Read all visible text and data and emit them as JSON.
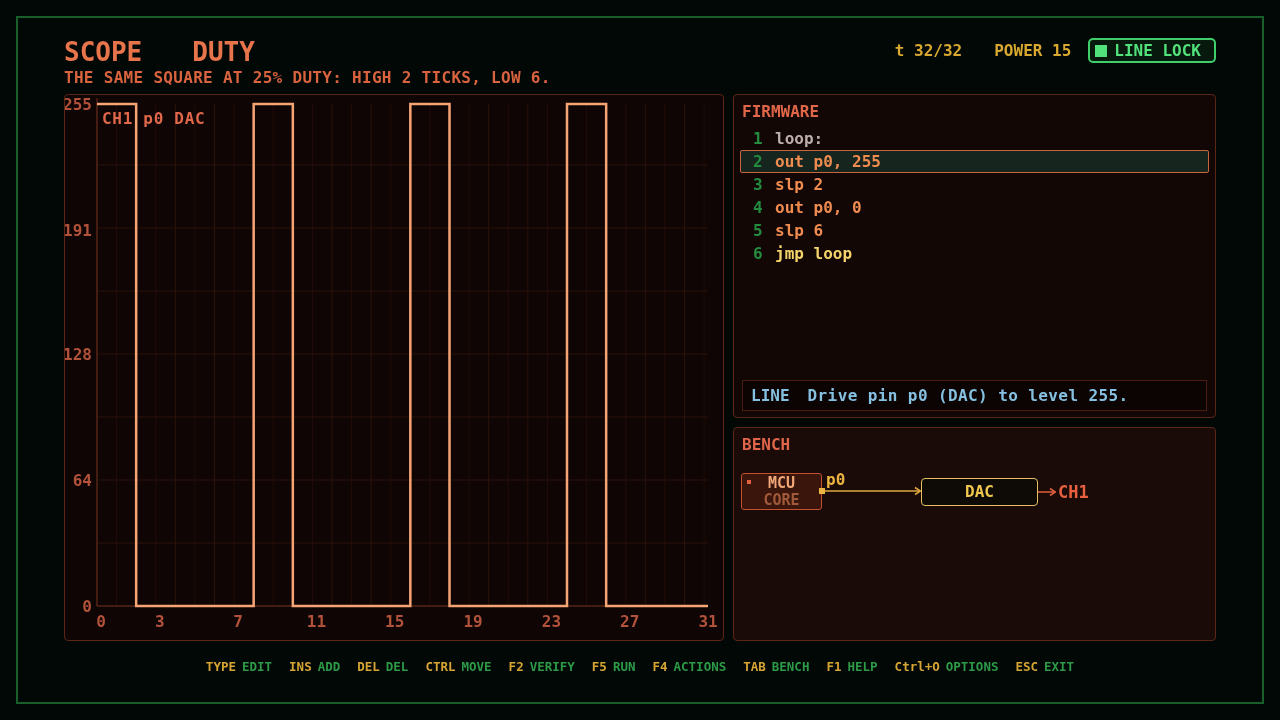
{
  "header": {
    "mode": "SCOPE",
    "title": "DUTY",
    "subtitle": "THE SAME SQUARE AT 25% DUTY: HIGH 2 TICKS, LOW 6.",
    "time": "t 32/32",
    "power": "POWER 15",
    "line_lock": {
      "label": "LINE LOCK",
      "on": true
    }
  },
  "scope": {
    "chart_data": {
      "type": "line",
      "x": [
        0,
        2,
        2,
        8,
        8,
        10,
        10,
        16,
        16,
        18,
        18,
        24,
        24,
        26,
        26,
        31.2
      ],
      "series": [
        {
          "name": "CH1 p0 DAC",
          "color": "#f6a474",
          "values": [
            255,
            255,
            0,
            0,
            255,
            255,
            0,
            0,
            255,
            255,
            0,
            0,
            255,
            255,
            0,
            0
          ]
        }
      ],
      "xlim": [
        0,
        31.2
      ],
      "ylim": [
        0,
        255
      ],
      "xticks": [
        0,
        3,
        7,
        11,
        15,
        19,
        23,
        27,
        31
      ],
      "yticks": [
        0,
        64,
        128,
        191,
        255
      ],
      "grid": true
    }
  },
  "firmware": {
    "title": "FIRMWARE",
    "lines": [
      {
        "number": "1",
        "code": "loop:",
        "kind": "label",
        "selected": false
      },
      {
        "number": "2",
        "code": "out p0, 255",
        "kind": "op",
        "selected": true
      },
      {
        "number": "3",
        "code": "slp 2",
        "kind": "op",
        "selected": false
      },
      {
        "number": "4",
        "code": "out p0, 0",
        "kind": "op",
        "selected": false
      },
      {
        "number": "5",
        "code": "slp 6",
        "kind": "op",
        "selected": false
      },
      {
        "number": "6",
        "code": "jmp loop",
        "kind": "jump",
        "selected": false
      }
    ],
    "line_info": {
      "label": "LINE",
      "text": "Drive pin p0 (DAC) to level 255."
    }
  },
  "bench": {
    "title": "BENCH",
    "nodes": [
      {
        "kind": "mcu",
        "label": "MCU",
        "sublabel": "CORE"
      },
      {
        "kind": "converter",
        "label": "DAC"
      }
    ],
    "wires": [
      {
        "label": "p0"
      }
    ],
    "output": "CH1"
  },
  "footer": {
    "hints": [
      {
        "key": "TYPE",
        "action": "EDIT"
      },
      {
        "key": "INS",
        "action": "ADD"
      },
      {
        "key": "DEL",
        "action": "DEL"
      },
      {
        "key": "CTRL",
        "action": "MOVE"
      },
      {
        "key": "F2",
        "action": "VERIFY"
      },
      {
        "key": "F5",
        "action": "RUN"
      },
      {
        "key": "F4",
        "action": "ACTIONS"
      },
      {
        "key": "TAB",
        "action": "BENCH"
      },
      {
        "key": "F1",
        "action": "HELP"
      },
      {
        "key": "Ctrl+O",
        "action": "OPTIONS"
      },
      {
        "key": "ESC",
        "action": "EXIT"
      }
    ]
  }
}
